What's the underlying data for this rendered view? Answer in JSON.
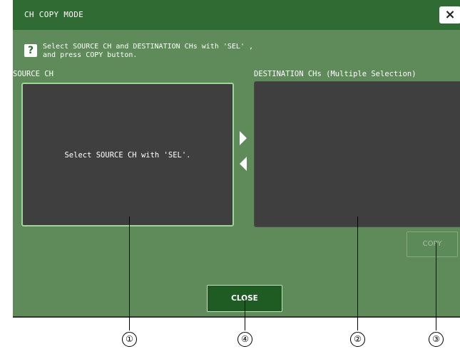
{
  "window": {
    "title": "CH COPY MODE",
    "close_icon": "×"
  },
  "help": {
    "icon": "?",
    "line1": "Select SOURCE CH and DESTINATION CHs with 'SEL' ,",
    "line2": "and press COPY button."
  },
  "source": {
    "label": "SOURCE CH",
    "placeholder": "Select SOURCE CH with 'SEL'."
  },
  "destination": {
    "label": "DESTINATION CHs (Multiple Selection)"
  },
  "buttons": {
    "copy": "COPY",
    "close": "CLOSE"
  },
  "callouts": [
    "①",
    "②",
    "③",
    "④"
  ]
}
